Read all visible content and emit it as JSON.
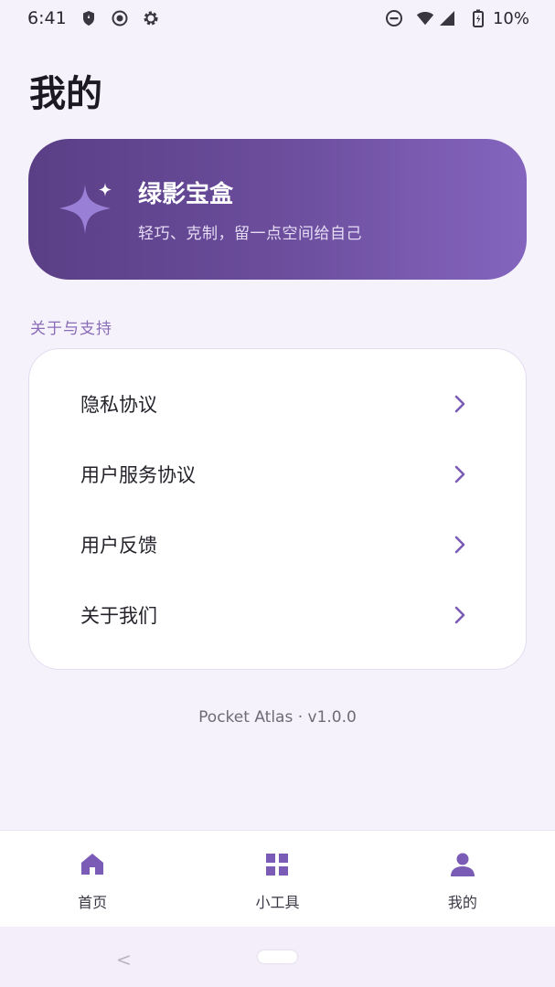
{
  "status_bar": {
    "time": "6:41",
    "battery": "10%",
    "left_icons": [
      "shield-icon",
      "record-icon",
      "gear-icon"
    ],
    "right_icons": [
      "dnd-icon",
      "wifi-icon",
      "signal-icon",
      "battery-icon"
    ]
  },
  "page": {
    "title": "我的"
  },
  "hero": {
    "title": "绿影宝盒",
    "subtitle": "轻巧、克制，留一点空间给自己",
    "icon": "sparkle-icon"
  },
  "section": {
    "label": "关于与支持",
    "items": [
      {
        "label": "隐私协议",
        "icon": "chevron-right-icon"
      },
      {
        "label": "用户服务协议",
        "icon": "chevron-right-icon"
      },
      {
        "label": "用户反馈",
        "icon": "chevron-right-icon"
      },
      {
        "label": "关于我们",
        "icon": "chevron-right-icon"
      }
    ]
  },
  "version": "Pocket Atlas · v1.0.0",
  "bottom_nav": {
    "items": [
      {
        "label": "首页",
        "icon": "home-icon"
      },
      {
        "label": "小工具",
        "icon": "grid-icon"
      },
      {
        "label": "我的",
        "icon": "person-icon"
      }
    ]
  },
  "colors": {
    "accent": "#7a5bb5",
    "hero_gradient_start": "#5a3f86",
    "hero_gradient_end": "#8465be",
    "background": "#f6f2fc"
  }
}
